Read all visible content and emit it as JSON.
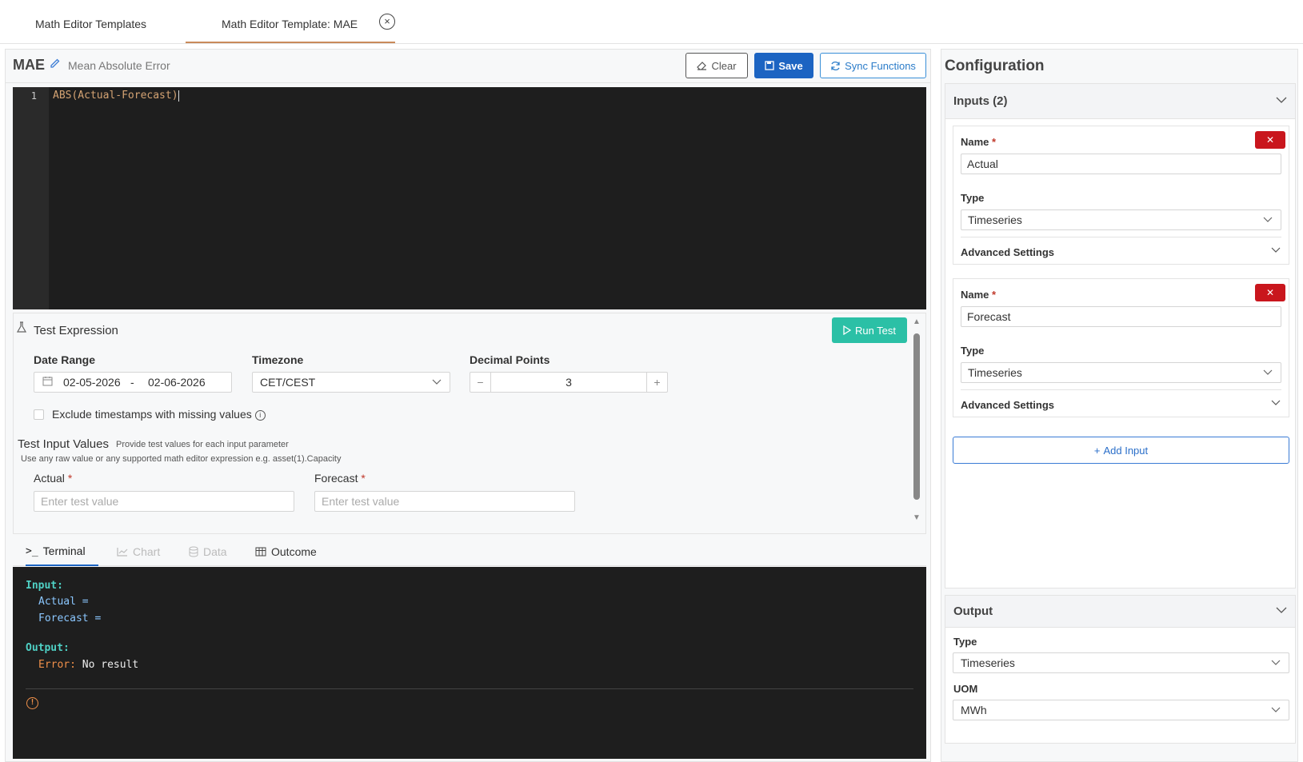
{
  "tabs": {
    "templates_label": "Math Editor Templates",
    "active_label": "Math Editor Template: MAE",
    "close_icon": "×"
  },
  "editor": {
    "title": "MAE",
    "subtitle": "Mean Absolute Error",
    "clear_label": "Clear",
    "save_label": "Save",
    "sync_label": "Sync Functions",
    "line_number": "1",
    "code": "ABS(Actual-Forecast)"
  },
  "test": {
    "title": "Test Expression",
    "run_label": "Run Test",
    "date_range_label": "Date Range",
    "date_from": "02-05-2026",
    "date_sep": "-",
    "date_to": "02-06-2026",
    "timezone_label": "Timezone",
    "timezone_value": "CET/CEST",
    "decimal_label": "Decimal Points",
    "decimal_value": "3",
    "decimal_minus": "−",
    "decimal_plus": "+",
    "exclude_label": "Exclude timestamps with missing values",
    "exclude_checked": false,
    "input_values_title": "Test Input Values",
    "input_values_hint": "Provide test values for each input parameter",
    "input_values_hint2": "Use any raw value or any supported math editor expression e.g. asset(1).Capacity",
    "actual_label": "Actual",
    "forecast_label": "Forecast",
    "required_mark": "*",
    "actual_placeholder": "Enter test value",
    "forecast_placeholder": "Enter test value"
  },
  "result_tabs": {
    "terminal": "Terminal",
    "chart": "Chart",
    "data": "Data",
    "outcome": "Outcome"
  },
  "terminal": {
    "input_head": "Input:",
    "actual_line": "Actual =",
    "forecast_line": "Forecast =",
    "output_head": "Output:",
    "error_label": "Error:",
    "error_text": " No result",
    "warn_icon": "!"
  },
  "config": {
    "title": "Configuration",
    "inputs_title": "Inputs (2)",
    "name_label": "Name",
    "type_label": "Type",
    "advanced_label": "Advanced Settings",
    "delete_label": "✕",
    "inputs": [
      {
        "name": "Actual",
        "type": "Timeseries"
      },
      {
        "name": "Forecast",
        "type": "Timeseries"
      }
    ],
    "add_input_label": "Add Input",
    "output_title": "Output",
    "output_type_label": "Type",
    "output_type": "Timeseries",
    "uom_label": "UOM",
    "uom_value": "MWh"
  },
  "colors": {
    "save_bg": "#1c64c2",
    "run_bg": "#2bc0a6",
    "delete_bg": "#c9161d",
    "terminal_bg": "#1e1e1e"
  }
}
